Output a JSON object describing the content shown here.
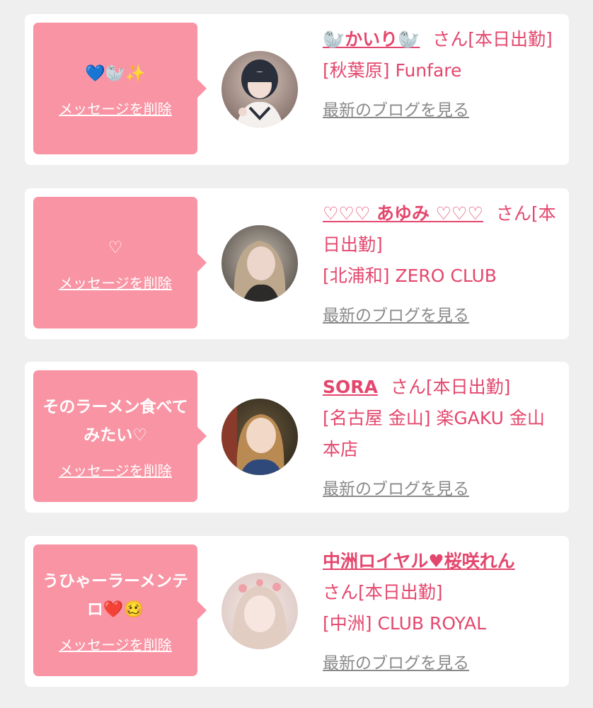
{
  "colors": {
    "background": "#efefef",
    "card": "#ffffff",
    "bubble": "#f994a4",
    "accent_text": "#e4476d",
    "blog_link": "#8a8a8a"
  },
  "messages": [
    {
      "bubble_text": "💙🦭✨",
      "delete_label": "メッセージを削除",
      "name": "🦭かいり🦭",
      "san_label": "さん[本日出勤]",
      "shop": "[秋葉原] Funfare",
      "blog_label": "最新のブログを見る"
    },
    {
      "bubble_text": "♡",
      "delete_label": "メッセージを削除",
      "name": "♡♡♡ あゆみ ♡♡♡",
      "san_label": "さん[本日出勤]",
      "shop": "[北浦和] ZERO CLUB",
      "blog_label": "最新のブログを見る"
    },
    {
      "bubble_text": "そのラーメン食べてみたい♡",
      "delete_label": "メッセージを削除",
      "name": "SORA",
      "san_label": "さん[本日出勤]",
      "shop": "[名古屋 金山] 楽GAKU 金山本店",
      "blog_label": "最新のブログを見る"
    },
    {
      "bubble_text": "うひゃーラーメンテロ❤️🥴",
      "delete_label": "メッセージを削除",
      "name": "中洲ロイヤル♥桜咲れん",
      "san_label": "さん[本日出勤]",
      "shop": "[中洲] CLUB ROYAL",
      "blog_label": "最新のブログを見る"
    }
  ]
}
